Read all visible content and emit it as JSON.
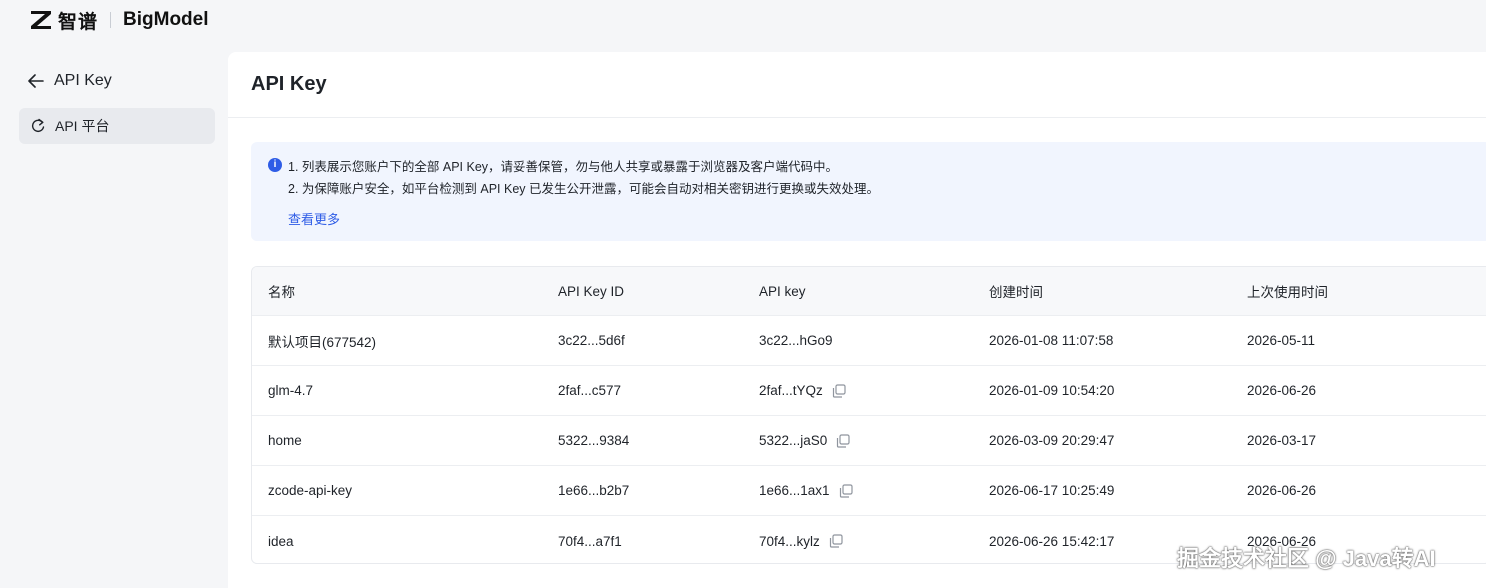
{
  "brand": {
    "cn": "智谱",
    "en": "BigModel"
  },
  "sidebar": {
    "back_label": "API Key",
    "items": [
      {
        "label": "API 平台"
      }
    ]
  },
  "main": {
    "title": "API Key",
    "notice": {
      "line1": "1. 列表展示您账户下的全部 API Key，请妥善保管，勿与他人共享或暴露于浏览器及客户端代码中。",
      "line2": "2. 为保障账户安全，如平台检测到 API Key 已发生公开泄露，可能会自动对相关密钥进行更换或失效处理。",
      "link": "查看更多"
    },
    "table": {
      "columns": [
        "名称",
        "API Key ID",
        "API key",
        "创建时间",
        "上次使用时间"
      ],
      "rows": [
        {
          "name": "默认项目(677542)",
          "key_id": "3c22...5d6f",
          "key": "3c22...hGo9",
          "created": "2026-01-08 11:07:58",
          "last_used": "2026-05-11",
          "copy": false
        },
        {
          "name": "glm-4.7",
          "key_id": "2faf...c577",
          "key": "2faf...tYQz",
          "created": "2026-01-09 10:54:20",
          "last_used": "2026-06-26",
          "copy": true
        },
        {
          "name": "home",
          "key_id": "5322...9384",
          "key": "5322...jaS0",
          "created": "2026-03-09 20:29:47",
          "last_used": "2026-03-17",
          "copy": true
        },
        {
          "name": "zcode-api-key",
          "key_id": "1e66...b2b7",
          "key": "1e66...1ax1",
          "created": "2026-06-17 10:25:49",
          "last_used": "2026-06-26",
          "copy": true
        },
        {
          "name": "idea",
          "key_id": "70f4...a7f1",
          "key": "70f4...kylz",
          "created": "2026-06-26 15:42:17",
          "last_used": "2026-06-26",
          "copy": true
        }
      ]
    }
  },
  "watermark": "掘金技术社区 @ Java转AI"
}
